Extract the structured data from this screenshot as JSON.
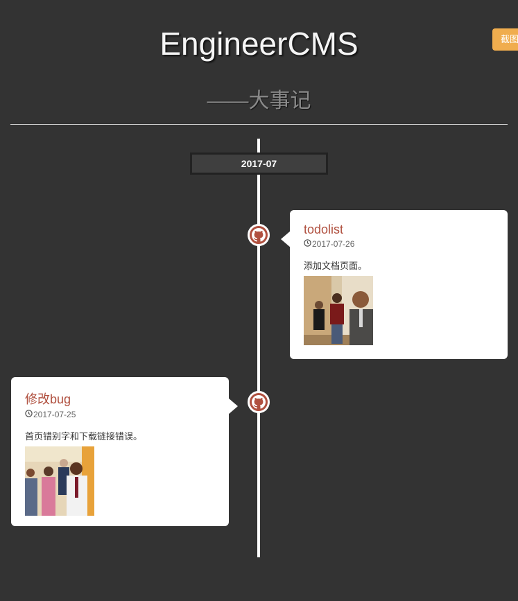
{
  "header": {
    "title": "EngineerCMS",
    "subtitle": "——大事记",
    "screenshot_button": "截图"
  },
  "timeline": {
    "month_badge": "2017-07",
    "events": [
      {
        "title": "todolist",
        "date": "2017-07-26",
        "description": "添加文档页面。",
        "icon": "github-icon",
        "side": "right"
      },
      {
        "title": "修改bug",
        "date": "2017-07-25",
        "description": "首页错别字和下载链接错误。",
        "icon": "github-icon",
        "side": "left"
      }
    ]
  },
  "colors": {
    "background": "#333333",
    "accent": "#b0503f",
    "button": "#f0ad4e"
  }
}
